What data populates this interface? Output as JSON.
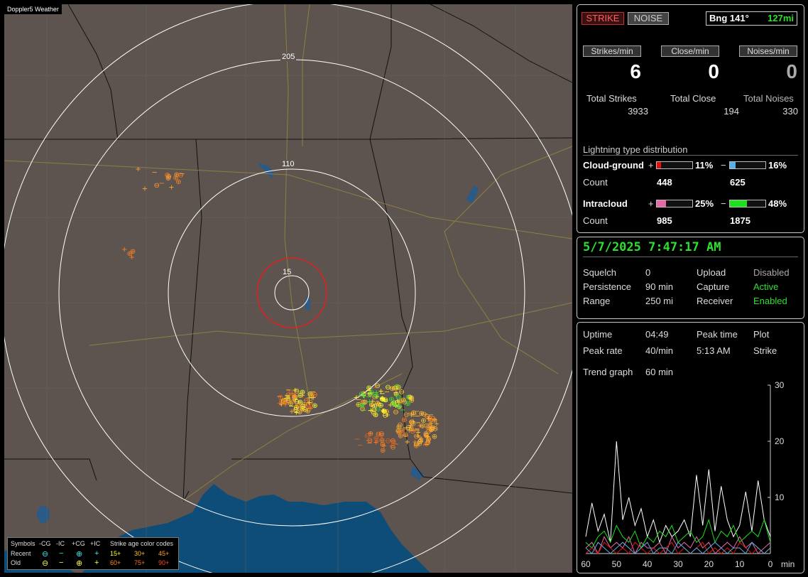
{
  "map": {
    "title": "Doppler5 Weather",
    "ring_labels": [
      "205",
      "110",
      "15"
    ],
    "legend": {
      "symbols_label": "Symbols",
      "headers": [
        "-CG",
        "-IC",
        "+CG",
        "+IC"
      ],
      "age_title": "Strike age color codes",
      "recent_label": "Recent",
      "old_label": "Old",
      "recent_ages": [
        "15+",
        "30+",
        "45+"
      ],
      "old_ages": [
        "60+",
        "75+",
        "90+"
      ],
      "sym_minus_cg": "⊖",
      "sym_minus_ic": "−",
      "sym_plus_cg": "⊕",
      "sym_plus_ic": "+"
    }
  },
  "status": {
    "strike_button": "STRIKE",
    "noise_button": "NOISE",
    "bearing": "Bng 141°",
    "distance": "127mi",
    "headers": [
      "Strikes/min",
      "Close/min",
      "Noises/min"
    ],
    "values": [
      "6",
      "0",
      "0"
    ],
    "total_labels": [
      "Total Strikes",
      "Total Close",
      "Total Noises"
    ],
    "totals": [
      "3933",
      "194",
      "330"
    ],
    "distribution_title": "Lightning type distribution",
    "cg_label": "Cloud-ground",
    "ic_label": "Intracloud",
    "count_label": "Count",
    "plus_sign": "+",
    "minus_sign": "−",
    "cg_plus_pct": "11%",
    "cg_minus_pct": "16%",
    "ic_plus_pct": "25%",
    "ic_minus_pct": "48%",
    "cg_plus_count": "448",
    "cg_minus_count": "625",
    "ic_plus_count": "985",
    "ic_minus_count": "1875",
    "bar_fractions": {
      "cg_plus": 0.11,
      "cg_minus": 0.16,
      "ic_plus": 0.25,
      "ic_minus": 0.48
    },
    "colors": {
      "cg_plus": "#e01010",
      "cg_minus": "#5aaee8",
      "ic_plus": "#e868a8",
      "ic_minus": "#1ee01e"
    }
  },
  "info": {
    "datetime": "5/7/2025 7:47:17 AM",
    "squelch_label": "Squelch",
    "squelch": "0",
    "persistence_label": "Persistence",
    "persistence": "90 min",
    "range_label": "Range",
    "range": "250 mi",
    "upload_label": "Upload",
    "upload": "Disabled",
    "capture_label": "Capture",
    "capture": "Active",
    "receiver_label": "Receiver",
    "receiver": "Enabled"
  },
  "trend": {
    "uptime_label": "Uptime",
    "uptime": "04:49",
    "peak_time_label": "Peak time",
    "peak_time": "5:13 AM",
    "plot_label": "Plot",
    "plot": "Strike",
    "peak_rate_label": "Peak rate",
    "peak_rate": "40/min",
    "trend_graph_label": "Trend graph",
    "trend_graph": "60 min"
  },
  "chart_data": {
    "type": "line",
    "xlabel": "min",
    "x_ticks": [
      "60",
      "50",
      "40",
      "30",
      "20",
      "10",
      "0"
    ],
    "y_ticks": [
      "30",
      "20",
      "10"
    ],
    "xlim": [
      60,
      0
    ],
    "ylim": [
      0,
      30
    ],
    "x": [
      60,
      58,
      56,
      54,
      52,
      50,
      48,
      46,
      44,
      42,
      40,
      38,
      36,
      34,
      32,
      30,
      28,
      26,
      24,
      22,
      20,
      18,
      16,
      14,
      12,
      10,
      8,
      6,
      4,
      2,
      0
    ],
    "series": [
      {
        "color": "#ffffff",
        "values": [
          3,
          9,
          4,
          7,
          2,
          20,
          6,
          10,
          5,
          8,
          3,
          6,
          2,
          5,
          3,
          4,
          6,
          3,
          14,
          5,
          15,
          4,
          12,
          6,
          3,
          5,
          11,
          4,
          13,
          6,
          3
        ]
      },
      {
        "color": "#e868a8",
        "values": [
          1,
          2,
          0,
          3,
          1,
          2,
          1,
          3,
          0,
          2,
          1,
          1,
          2,
          0,
          3,
          1,
          2,
          1,
          3,
          1,
          2,
          0,
          1,
          2,
          1,
          3,
          1,
          2,
          0,
          1,
          2
        ]
      },
      {
        "color": "#1ee01e",
        "values": [
          2,
          1,
          3,
          4,
          2,
          5,
          3,
          2,
          4,
          1,
          3,
          2,
          4,
          3,
          5,
          2,
          3,
          4,
          2,
          3,
          6,
          2,
          4,
          3,
          5,
          2,
          3,
          4,
          3,
          6,
          2
        ]
      },
      {
        "color": "#e01010",
        "values": [
          0,
          1,
          0,
          2,
          1,
          0,
          1,
          0,
          2,
          1,
          0,
          1,
          0,
          1,
          2,
          0,
          1,
          0,
          1,
          2,
          0,
          1,
          0,
          1,
          0,
          2,
          1,
          0,
          1,
          0,
          1
        ]
      },
      {
        "color": "#5aaee8",
        "values": [
          1,
          0,
          2,
          1,
          0,
          1,
          2,
          1,
          0,
          1,
          2,
          0,
          1,
          1,
          0,
          2,
          1,
          0,
          1,
          0,
          1,
          2,
          1,
          0,
          1,
          1,
          0,
          2,
          1,
          0,
          1
        ]
      }
    ]
  }
}
